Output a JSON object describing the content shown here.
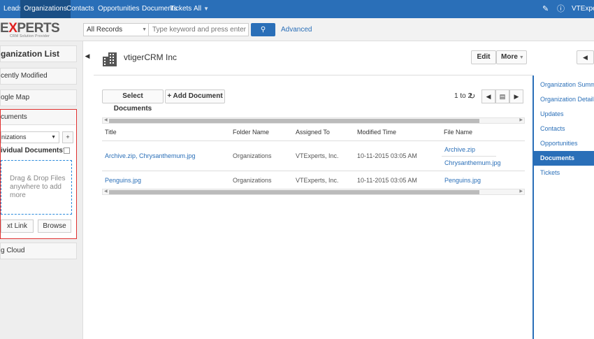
{
  "topnav": {
    "items": [
      "Leads",
      "Organizations",
      "Contacts",
      "Opportunities",
      "Documents",
      "Tickets",
      "All"
    ],
    "active": "Organizations",
    "user": "VTExpert"
  },
  "subbar": {
    "logo_text_a": "E",
    "logo_text_x": "X",
    "logo_text_b": "PERTS",
    "logo_tagline": "CRM Solution Provider",
    "records_select": "All Records",
    "search_placeholder": "Type keyword and press enter",
    "advanced": "Advanced"
  },
  "sidebar": {
    "org_list": "ganization List",
    "recently_modified": "cently Modified",
    "google_map": "ogle Map",
    "documents": {
      "title": "cuments",
      "folder": "nizations",
      "individual": "ividual Documents?",
      "dropzone": "Drag & Drop Files anywhere to add more",
      "text_link": "xt Link",
      "browse": "Browse"
    },
    "tag_cloud": "g Cloud"
  },
  "record": {
    "title": "vtigerCRM Inc",
    "edit": "Edit",
    "more": "More"
  },
  "docs": {
    "select_docs": "Select Documents",
    "add_doc": "+ Add Document",
    "paging": "1 to 2",
    "columns": [
      "Title",
      "Folder Name",
      "Assigned To",
      "Modified Time",
      "File Name"
    ],
    "rows": [
      {
        "title": "Archive.zip, Chrysanthemum.jpg",
        "folder": "Organizations",
        "assigned": "VTExperts, Inc.",
        "modified": "10-11-2015 03:05 AM",
        "file1": "Archive.zip",
        "file2": "Chrysanthemum.jpg"
      },
      {
        "title": "Penguins.jpg",
        "folder": "Organizations",
        "assigned": "VTExperts, Inc.",
        "modified": "10-11-2015 03:05 AM",
        "file1": "Penguins.jpg"
      }
    ]
  },
  "rightpanel": {
    "items": [
      "Organization Summary",
      "Organization Details",
      "Updates",
      "Contacts",
      "Opportunities",
      "Documents",
      "Tickets"
    ],
    "active": "Documents"
  },
  "colors": {
    "nav_blue": "#2a6fb8",
    "highlight_red": "#e0302f"
  }
}
